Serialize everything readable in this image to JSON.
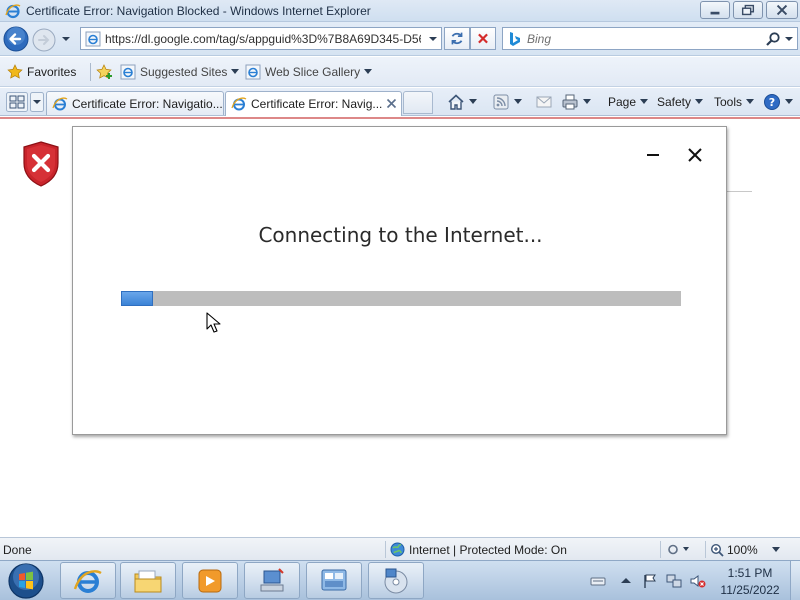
{
  "window": {
    "title": "Certificate Error: Navigation Blocked - Windows Internet Explorer"
  },
  "address_bar": {
    "url": "https://dl.google.com/tag/s/appguid%3D%7B8A69D345-D564"
  },
  "search": {
    "placeholder": "Bing"
  },
  "favorites_bar": {
    "favorites_label": "Favorites",
    "items": [
      {
        "label": "Suggested Sites"
      },
      {
        "label": "Web Slice Gallery"
      }
    ]
  },
  "tabs": [
    {
      "label": "Certificate Error: Navigatio..."
    },
    {
      "label": "Certificate Error: Navig..."
    }
  ],
  "command_bar": {
    "page_label": "Page",
    "safety_label": "Safety",
    "tools_label": "Tools"
  },
  "dialog": {
    "message": "Connecting to the Internet...",
    "progress": 0.057
  },
  "status_bar": {
    "status": "Done",
    "zone": "Internet | Protected Mode: On",
    "zoom": "100%"
  },
  "taskbar": {
    "time": "1:51 PM",
    "date": "11/25/2022"
  },
  "colors": {
    "progress_fill": "#3b83d6",
    "progress_track": "#bdbdbd",
    "shield_red": "#c8242b"
  },
  "icons": [
    "ie-icon",
    "back-icon",
    "forward-icon",
    "refresh-icon",
    "stop-icon",
    "bing-icon",
    "search-icon",
    "favorites-star-icon",
    "add-favorites-icon",
    "quick-tabs-icon",
    "home-icon",
    "feeds-icon",
    "mail-icon",
    "print-icon",
    "help-icon",
    "shield-error-icon",
    "globe-icon",
    "zoom-icon",
    "start-orb-icon"
  ]
}
